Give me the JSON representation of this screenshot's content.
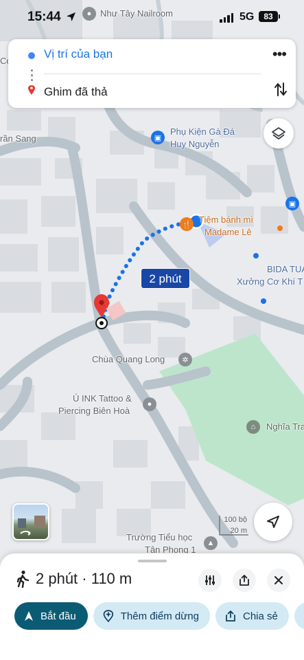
{
  "status_bar": {
    "time": "15:44",
    "network": "5G",
    "battery": "83"
  },
  "route": {
    "origin_label": "Vị trí của bạn",
    "destination_label": "Ghim đã thả"
  },
  "map": {
    "labels": {
      "nailroom": "Như Tây Nailroom",
      "phu_kien_1": "Phụ Kiện Gà Đá",
      "phu_kien_2": "Huy Nguyễn",
      "tran_sang": "rần Sang",
      "tiem_banh_1": "Tiệm bánh mì",
      "tiem_banh_2": "Madame Lê",
      "bida": "BIDA TUA",
      "xuong": "Xưởng Cơ Khí T",
      "chua": "Chùa Quang Long",
      "tattoo_1": "Ú INK Tattoo &",
      "tattoo_2": "Piercing Biên Hoà",
      "nghia_trang": "Nghĩa Tra",
      "truong_1": "Trường Tiểu học",
      "truong_2": "Tân Phong 1",
      "co": "Co"
    },
    "eta_bubble": "2 phút",
    "scale_top": "100 bộ",
    "scale_bottom": "20 m"
  },
  "sheet": {
    "summary": "2 phút · 110 m",
    "chips": {
      "start": "Bắt đầu",
      "add_stop": "Thêm điểm dừng",
      "share": "Chia sẻ"
    }
  },
  "colors": {
    "route_blue": "#1a73e8",
    "eta_bubble": "#1a47a6",
    "start_chip": "#0b5b74",
    "chip_bg": "#d3e9f4",
    "park_green": "#bde5cc",
    "pin_red": "#e53935"
  },
  "icons": [
    "navigation-arrow-icon",
    "more-icon",
    "swap-icon",
    "layers-icon",
    "locate-icon",
    "walk-icon",
    "filter-icon",
    "share-icon",
    "close-icon",
    "add-stop-icon",
    "start-arrow-icon"
  ]
}
